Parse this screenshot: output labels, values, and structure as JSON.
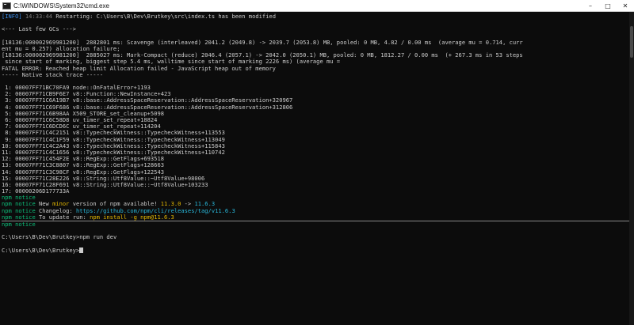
{
  "window": {
    "title": "C:\\WINDOWS\\System32\\cmd.exe",
    "icon": "cmd-icon",
    "controls": [
      "minimize-icon",
      "maximize-icon",
      "close-icon"
    ]
  },
  "log": {
    "restart_tag": "[INFO]",
    "restart_time": "14:33:44",
    "restart_msg": "Restarting: C:\\Users\\B\\Dev\\Brutkey\\src\\index.ts has been modified",
    "gc_header": "<--- Last few GCs --->",
    "gc_line1": "[18136:000002969981200]  2882801 ms: Scavenge (interleaved) 2041.2 (2049.8) -> 2039.7 (2053.8) MB, pooled: 0 MB, 4.82 / 0.00 ms  (average mu = 0.714, curr",
    "gc_line2": "ent mu = 0.257) allocation failure;",
    "gc_line3": "[18136:000002969981200]  2885027 ms: Mark-Compact (reduce) 2046.4 (2057.1) -> 2042.0 (2050.1) MB, pooled: 0 MB, 1812.27 / 0.00 ms  (+ 267.3 ms in 53 steps",
    "gc_line4": " since start of marking, biggest step 5.4 ms, walltime since start of marking 2226 ms) (average mu =",
    "fatal": "FATAL ERROR: Reached heap limit Allocation failed - JavaScript heap out of memory",
    "stack_header": "----- Native stack trace -----"
  },
  "stack": [
    " 1: 00007FF71BC70FA9 node::OnFatalError+1193",
    " 2: 00007FF71CB9F6E7 v8::Function::NewInstance+423",
    " 3: 00007FF71C6A19B7 v8::base::AddressSpaceReservation::AddressSpaceReservation+320967",
    " 4: 00007FF71C69F686 v8::base::AddressSpaceReservation::AddressSpaceReservation+312806",
    " 5: 00007FF71C6B98AA X509_STORE_set_cleanup+5098",
    " 6: 00007FF71C6C58D8 uv_timer_set_repeat+18824",
    " 7: 00007FF71C6DCD6C uv_timer_set_repeat+114204",
    " 8: 00007FF71C4C2151 v8::TypecheckWitness::TypecheckWitness+113553",
    " 9: 00007FF71C4C1F59 v8::TypecheckWitness::TypecheckWitness+113049",
    "10: 00007FF71C4C2A43 v8::TypecheckWitness::TypecheckWitness+115843",
    "11: 00007FF71C4C1656 v8::TypecheckWitness::TypecheckWitness+110742",
    "12: 00007FF71C454F2E v8::RegExp::GetFlags+693518",
    "13: 00007FF71C3C8807 v8::RegExp::GetFlags+128663",
    "14: 00007FF71C3C98CF v8::RegExp::GetFlags+122543",
    "15: 00007FF71C28E226 v8::String::Utf8Value::~Utf8Value+98006",
    "16: 00007FF71C28F691 v8::String::Utf8Value::~Utf8Value+103233",
    "17: 00000206D177733A"
  ],
  "npm": {
    "prefix": "npm",
    "notice": "notice",
    "new_a": "New ",
    "minor": "minor",
    "new_b": " version of npm available! ",
    "from_ver": "11.3.0",
    "arrow": " -> ",
    "to_ver": "11.6.3",
    "changelog_label": "Changelog: ",
    "changelog_url": "https://github.com/npm/cli/releases/tag/v11.6.3",
    "update_label": "To update run: ",
    "update_cmd": "npm install -g npm@11.6.3"
  },
  "prompt": {
    "path1": "C:\\Users\\B\\Dev\\Brutkey>",
    "cmd1": "npm run dev",
    "path2": "C:\\Users\\B\\Dev\\Brutkey>"
  }
}
